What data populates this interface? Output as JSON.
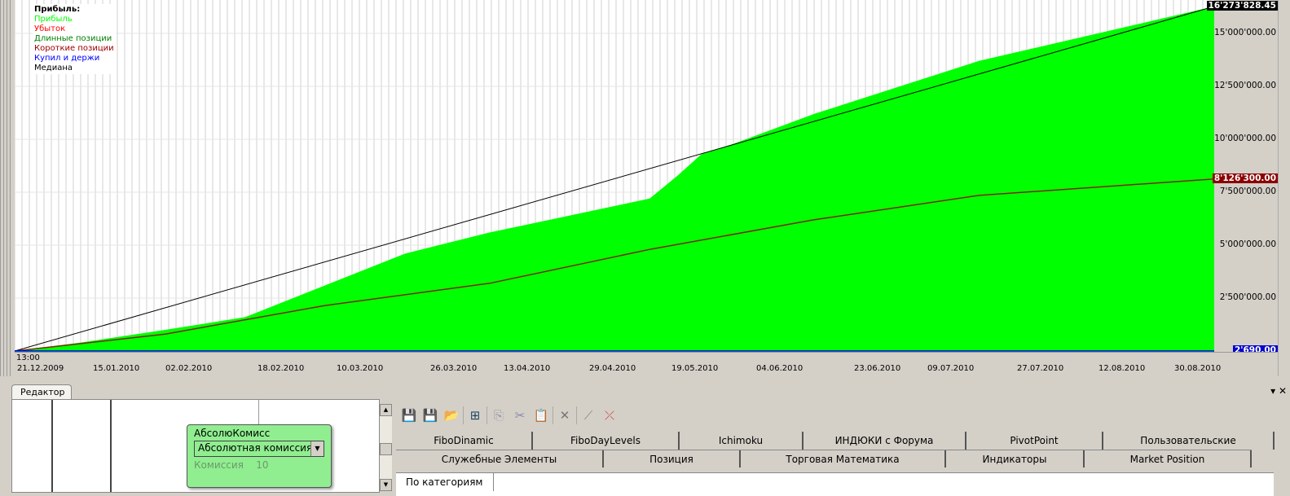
{
  "legend": {
    "title": "Прибыль:",
    "items": [
      {
        "label": "Прибыль",
        "color": "#00ff00"
      },
      {
        "label": "Убыток",
        "color": "#ff0000"
      },
      {
        "label": "Длинные позиции",
        "color": "#008000"
      },
      {
        "label": "Короткие позиции",
        "color": "#a00000"
      },
      {
        "label": "Купил и держи",
        "color": "#0000ff"
      },
      {
        "label": "Медиана",
        "color": "#000000"
      }
    ]
  },
  "chart_data": {
    "type": "area",
    "x_unit": "days since 21.12.2009",
    "xlim": [
      0,
      255
    ],
    "ylim": [
      0,
      16600000
    ],
    "y_ticks": [
      "2'500'000.00",
      "5'000'000.00",
      "7'500'000.00",
      "10'000'000.00",
      "12'500'000.00",
      "15'000'000.00"
    ],
    "y_tick_values": [
      2500000,
      5000000,
      7500000,
      10000000,
      12500000,
      15000000
    ],
    "x_first_label_time": "13:00",
    "x_ticks": [
      "21.12.2009",
      "15.01.2010",
      "02.02.2010",
      "18.02.2010",
      "10.03.2010",
      "26.03.2010",
      "13.04.2010",
      "29.04.2010",
      "19.05.2010",
      "04.06.2010",
      "23.06.2010",
      "09.07.2010",
      "27.07.2010",
      "12.08.2010",
      "30.08.2010"
    ],
    "badges": {
      "profit": "16'273'828.45",
      "short": "8'126'300.00",
      "buyhold": "2'690.00"
    },
    "series": [
      {
        "name": "Прибыль",
        "color": "#00ff00",
        "points": [
          [
            0,
            0
          ],
          [
            14,
            400000
          ],
          [
            32,
            1000000
          ],
          [
            49,
            1600000
          ],
          [
            66,
            3100000
          ],
          [
            83,
            4600000
          ],
          [
            101,
            5600000
          ],
          [
            118,
            6400000
          ],
          [
            135,
            7200000
          ],
          [
            141,
            8300000
          ],
          [
            146,
            9300000
          ],
          [
            153,
            9800000
          ],
          [
            170,
            11200000
          ],
          [
            205,
            13700000
          ],
          [
            255,
            16273828
          ]
        ]
      },
      {
        "name": "Короткие позиции",
        "color": "#a00000",
        "points": [
          [
            0,
            0
          ],
          [
            32,
            800000
          ],
          [
            66,
            2150000
          ],
          [
            101,
            3200000
          ],
          [
            135,
            4800000
          ],
          [
            170,
            6200000
          ],
          [
            205,
            7350000
          ],
          [
            255,
            8126300
          ]
        ]
      },
      {
        "name": "Медиана",
        "color": "#000000",
        "points": [
          [
            0,
            0
          ],
          [
            255,
            16273828
          ]
        ]
      },
      {
        "name": "Купил и держи",
        "color": "#0000ff",
        "points": [
          [
            0,
            2690
          ],
          [
            255,
            2690
          ]
        ]
      }
    ]
  },
  "panel": {
    "tab": "Редактор",
    "close": "✕",
    "pin": "▾"
  },
  "node": {
    "title": "АбсолюКомисс",
    "select": "Абсолютная комиссия",
    "param_label": "Комиссия",
    "param_value": "10"
  },
  "tabs_row1": [
    "FiboDinamic",
    "FiboDayLevels",
    "Ichimoku",
    "ИНДЮКИ с Форума",
    "PivotPoint",
    "Пользовательские"
  ],
  "tabs_row2": [
    "Служебные Элементы",
    "Позиция",
    "Торговая Математика",
    "Индикаторы",
    "Market Position"
  ],
  "category_tab": "По категориям"
}
